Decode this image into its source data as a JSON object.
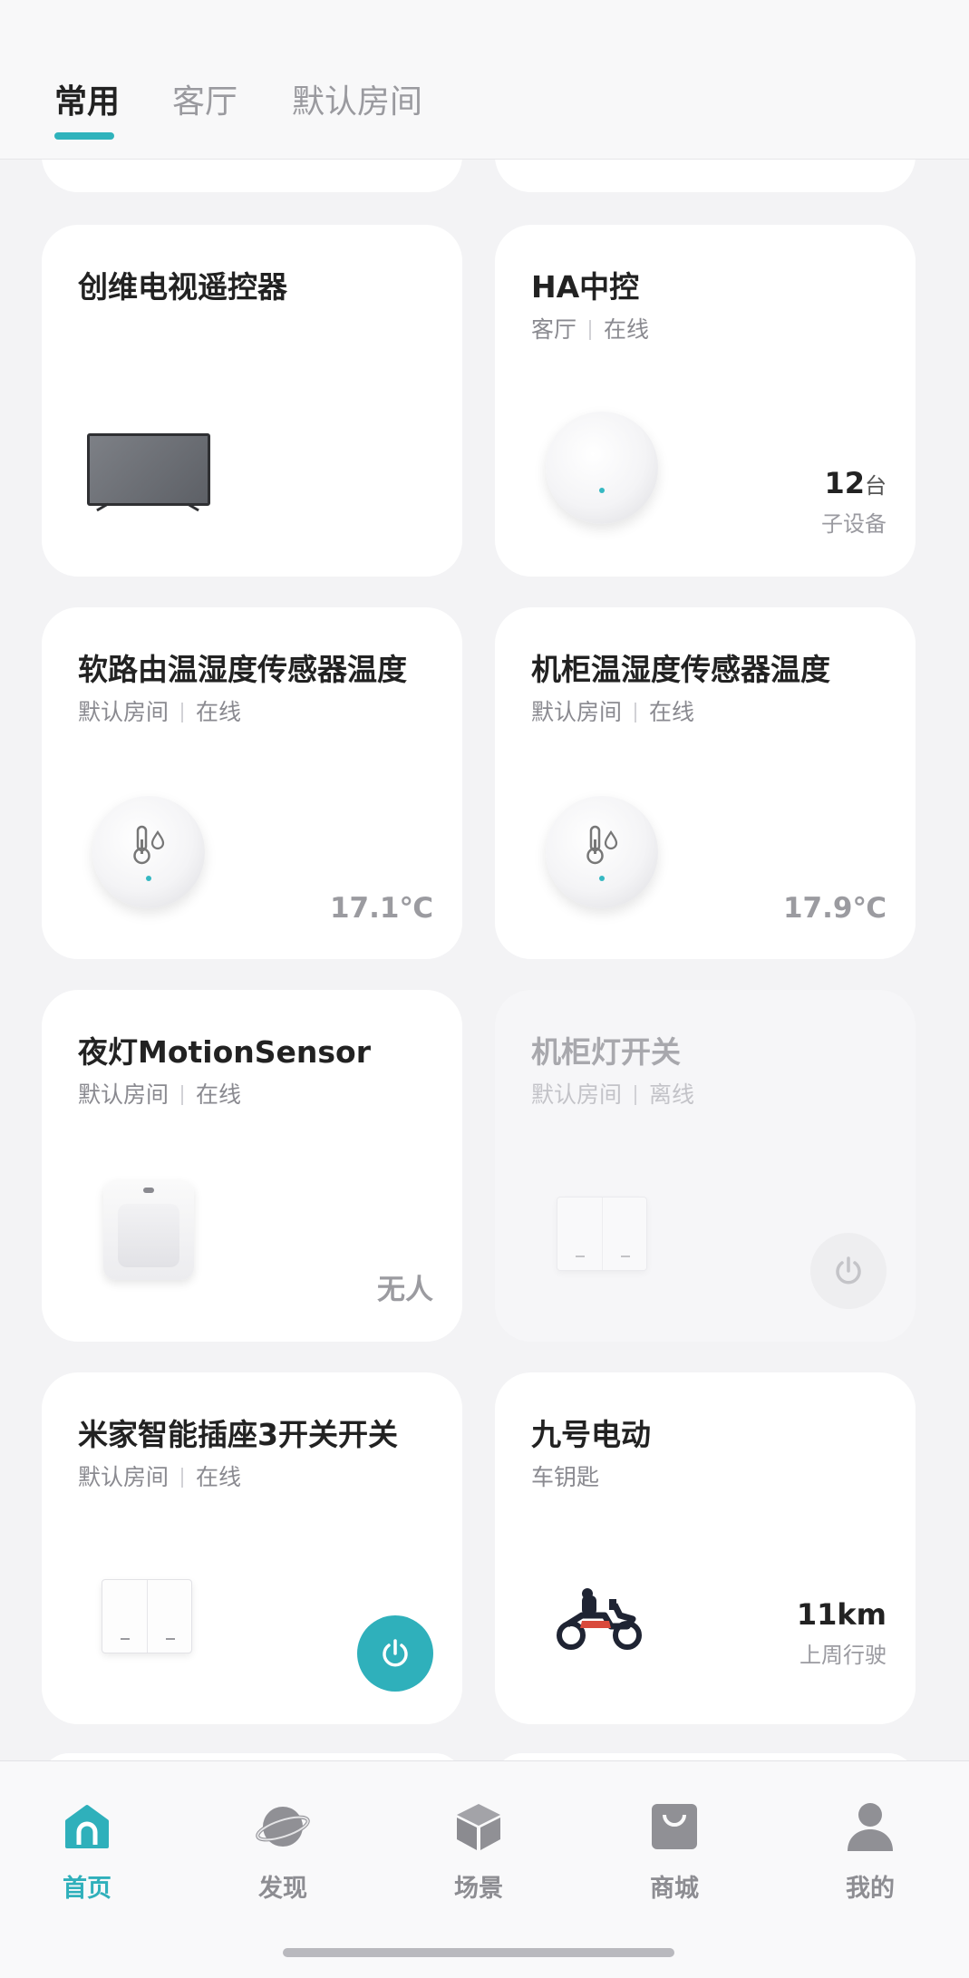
{
  "tabs": [
    {
      "label": "常用",
      "active": true
    },
    {
      "label": "客厅",
      "active": false
    },
    {
      "label": "默认房间",
      "active": false
    }
  ],
  "devices": [
    {
      "name": "创维电视遥控器",
      "room": "",
      "status": ""
    },
    {
      "name": "HA中控",
      "room": "客厅",
      "status": "在线",
      "stat_value": "12",
      "stat_unit": "台",
      "stat_label": "子设备"
    },
    {
      "name": "软路由温湿度传感器温度",
      "room": "默认房间",
      "status": "在线",
      "value": "17.1℃"
    },
    {
      "name": "机柜温湿度传感器温度",
      "room": "默认房间",
      "status": "在线",
      "value": "17.9℃"
    },
    {
      "name": "夜灯MotionSensor",
      "room": "默认房间",
      "status": "在线",
      "value": "无人"
    },
    {
      "name": "机柜灯开关",
      "room": "默认房间",
      "status": "离线"
    },
    {
      "name": "米家智能插座3开关开关",
      "room": "默认房间",
      "status": "在线"
    },
    {
      "name": "九号电动",
      "room": "车钥匙",
      "status": "",
      "stat_value": "11km",
      "stat_label": "上周行驶"
    }
  ],
  "bottom_nav": [
    {
      "label": "首页",
      "icon": "home-icon",
      "active": true
    },
    {
      "label": "发现",
      "icon": "planet-icon",
      "active": false
    },
    {
      "label": "场景",
      "icon": "cube-icon",
      "active": false
    },
    {
      "label": "商城",
      "icon": "shopping-bag-icon",
      "active": false
    },
    {
      "label": "我的",
      "icon": "person-icon",
      "active": false
    }
  ],
  "colors": {
    "accent": "#2fb0bb",
    "background": "#f3f3f5",
    "card": "#ffffff"
  }
}
